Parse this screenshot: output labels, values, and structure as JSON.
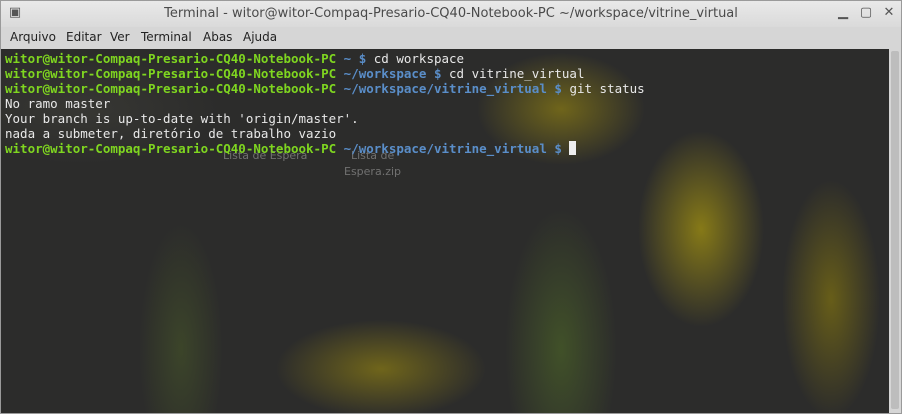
{
  "window": {
    "title": "Terminal - witor@witor-Compaq-Presario-CQ40-Notebook-PC ~/workspace/vitrine_virtual"
  },
  "menu": [
    "Arquivo",
    "Editar",
    "Ver",
    "Terminal",
    "Abas",
    "Ajuda"
  ],
  "desktop": {
    "label1": "Lista de Espera",
    "label2a": "Lista de",
    "label2b": "Espera.zip"
  },
  "terminal": {
    "lines": [
      {
        "user": "witor@witor-Compaq-Presario-CQ40-Notebook-PC",
        "path": " ~ $",
        "cmd": " cd workspace"
      },
      {
        "user": "witor@witor-Compaq-Presario-CQ40-Notebook-PC",
        "path": " ~/workspace $",
        "cmd": " cd vitrine_virtual"
      },
      {
        "user": "witor@witor-Compaq-Presario-CQ40-Notebook-PC",
        "path": " ~/workspace/vitrine_virtual $",
        "cmd": " git status"
      },
      {
        "text": "No ramo master"
      },
      {
        "text": "Your branch is up-to-date with 'origin/master'."
      },
      {
        "text": "nada a submeter, diretório de trabalho vazio"
      },
      {
        "user": "witor@witor-Compaq-Presario-CQ40-Notebook-PC",
        "path": " ~/workspace/vitrine_virtual $",
        "cmd": " "
      }
    ]
  }
}
